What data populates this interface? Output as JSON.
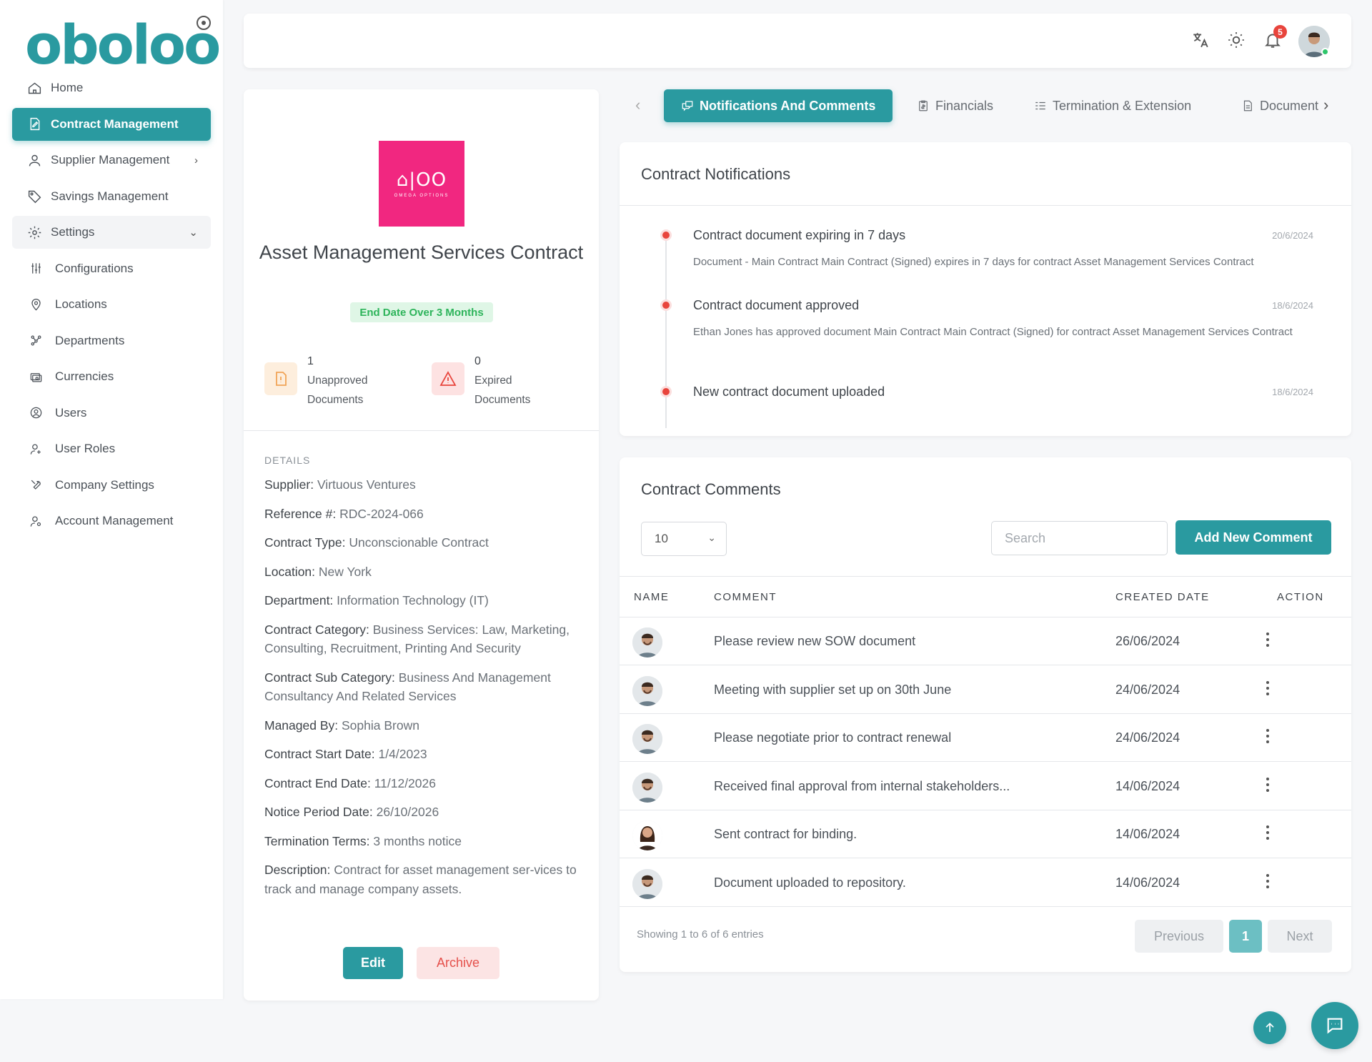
{
  "app": {
    "logo_text": "oboloo"
  },
  "sidebar": {
    "items": [
      {
        "label": "Home",
        "icon": "home-icon"
      },
      {
        "label": "Contract Management",
        "icon": "contract-icon",
        "active": true
      },
      {
        "label": "Supplier Management",
        "icon": "user-icon"
      },
      {
        "label": "Savings Management",
        "icon": "tag-icon"
      },
      {
        "label": "Settings",
        "icon": "gear-icon",
        "expanded": true
      }
    ],
    "settings_items": [
      {
        "label": "Configurations",
        "icon": "sliders-icon"
      },
      {
        "label": "Locations",
        "icon": "location-icon"
      },
      {
        "label": "Departments",
        "icon": "departments-icon"
      },
      {
        "label": "Currencies",
        "icon": "currency-icon"
      },
      {
        "label": "Users",
        "icon": "users-icon"
      },
      {
        "label": "User Roles",
        "icon": "user-role-icon"
      },
      {
        "label": "Company Settings",
        "icon": "tools-icon"
      },
      {
        "label": "Account Management",
        "icon": "account-icon"
      }
    ]
  },
  "topbar": {
    "notification_count": "5"
  },
  "contract": {
    "logo_mark": "⌂|OO",
    "logo_sub": "OMEGA OPTIONS",
    "title": "Asset Management Services Contract",
    "badge": "End Date Over 3 Months",
    "stats": [
      {
        "value": "1",
        "label_line1": "Unapproved",
        "label_line2": "Documents"
      },
      {
        "value": "0",
        "label_line1": "Expired",
        "label_line2": "Documents"
      }
    ],
    "details_heading": "DETAILS",
    "details": [
      {
        "label": "Supplier:",
        "value": "Virtuous Ventures"
      },
      {
        "label": "Reference #:",
        "value": "RDC-2024-066"
      },
      {
        "label": "Contract Type:",
        "value": "Unconscionable Contract"
      },
      {
        "label": "Location:",
        "value": "New York"
      },
      {
        "label": "Department:",
        "value": "Information Technology (IT)"
      },
      {
        "label": "Contract Category:",
        "value": "Business Services: Law, Marketing, Consulting, Recruitment, Printing And Security"
      },
      {
        "label": "Contract Sub Category:",
        "value": "Business And Management Consultancy And Related Services"
      },
      {
        "label": "Managed By:",
        "value": "Sophia Brown"
      },
      {
        "label": "Contract Start Date:",
        "value": "1/4/2023"
      },
      {
        "label": "Contract End Date:",
        "value": "11/12/2026"
      },
      {
        "label": "Notice Period Date:",
        "value": "26/10/2026"
      },
      {
        "label": "Termination Terms:",
        "value": "3 months notice"
      },
      {
        "label": "Description:",
        "value": "Contract for asset management ser-vices to track and manage company assets."
      }
    ],
    "edit_label": "Edit",
    "archive_label": "Archive"
  },
  "tabs": [
    {
      "label": "Notifications And Comments",
      "icon": "comments-icon",
      "active": true
    },
    {
      "label": "Financials",
      "icon": "clipboard-icon"
    },
    {
      "label": "Termination & Extension",
      "icon": "list-icon"
    },
    {
      "label": "Document",
      "icon": "document-icon"
    }
  ],
  "notifications": {
    "title": "Contract Notifications",
    "items": [
      {
        "title": "Contract document expiring in 7 days",
        "date": "20/6/2024",
        "body": "Document - Main Contract Main Contract (Signed) expires in 7 days for contract Asset Management Services Contract"
      },
      {
        "title": "Contract document approved",
        "date": "18/6/2024",
        "body": "Ethan Jones has approved document Main Contract Main Contract (Signed) for contract Asset Management Services Contract"
      },
      {
        "title": "New contract document uploaded",
        "date": "18/6/2024",
        "body": ""
      }
    ]
  },
  "comments": {
    "title": "Contract Comments",
    "page_size": "10",
    "search_placeholder": "Search",
    "add_label": "Add New Comment",
    "columns": [
      "NAME",
      "COMMENT",
      "CREATED DATE",
      "ACTION"
    ],
    "rows": [
      {
        "comment": "Please review new SOW document",
        "date": "26/06/2024",
        "avatar": "male"
      },
      {
        "comment": "Meeting with supplier set up on 30th June",
        "date": "24/06/2024",
        "avatar": "male"
      },
      {
        "comment": "Please negotiate prior to contract renewal",
        "date": "24/06/2024",
        "avatar": "male"
      },
      {
        "comment": "Received final approval from internal stakeholders...",
        "date": "14/06/2024",
        "avatar": "male"
      },
      {
        "comment": "Sent contract for binding.",
        "date": "14/06/2024",
        "avatar": "female"
      },
      {
        "comment": "Document uploaded to repository.",
        "date": "14/06/2024",
        "avatar": "male"
      }
    ],
    "footer_info": "Showing 1 to 6 of 6 entries",
    "prev_label": "Previous",
    "current_page": "1",
    "next_label": "Next"
  },
  "colors": {
    "accent": "#2a9aa0",
    "danger": "#e8443c",
    "success": "#2eb45b",
    "brand_logo_bg": "#f12780"
  }
}
